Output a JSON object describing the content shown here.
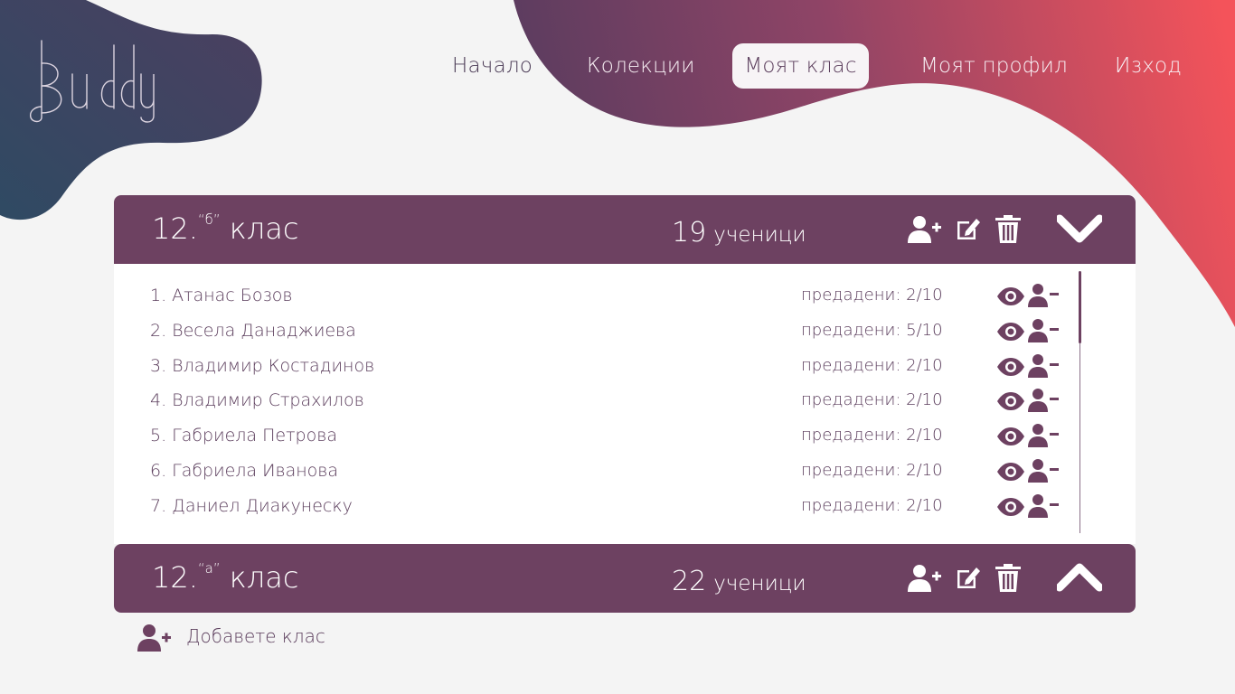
{
  "app": {
    "logo_text": "Buddy"
  },
  "nav": {
    "home": "Начало",
    "collections": "Колекции",
    "my_class": "Моят клас",
    "my_profile": "Моят профил",
    "exit": "Изход"
  },
  "classes": [
    {
      "title_prefix": "12.",
      "title_letter": "“б”",
      "title_suffix": "клас",
      "count": "19",
      "count_label": "ученици",
      "expanded": true,
      "students": [
        {
          "name": "1. Атанас Бозов",
          "submitted": "предадени: 2/10"
        },
        {
          "name": "2. Весела Данаджиева",
          "submitted": "предадени: 5/10"
        },
        {
          "name": "3. Владимир Костадинов",
          "submitted": "предадени: 2/10"
        },
        {
          "name": "4. Владимир Страхилов",
          "submitted": "предадени: 2/10"
        },
        {
          "name": "5. Габриела Петрова",
          "submitted": "предадени: 2/10"
        },
        {
          "name": "6. Габриела Иванова",
          "submitted": "предадени: 2/10"
        },
        {
          "name": "7. Даниел Диакунеску",
          "submitted": "предадени: 2/10"
        }
      ]
    },
    {
      "title_prefix": "12.",
      "title_letter": "“а”",
      "title_suffix": "клас",
      "count": "22",
      "count_label": "ученици",
      "expanded": false
    }
  ],
  "add_class": {
    "label": "Добавете клас"
  },
  "colors": {
    "primary": "#6d4161",
    "gradient_start": "#2f4460",
    "gradient_end": "#f2545a",
    "background": "#f4f4f4"
  },
  "icons": {
    "add_student": "user-plus-icon",
    "edit": "edit-icon",
    "delete": "trash-icon",
    "expand": "chevron-down-icon",
    "collapse": "chevron-up-icon",
    "view": "eye-icon",
    "remove_student": "user-minus-icon"
  }
}
